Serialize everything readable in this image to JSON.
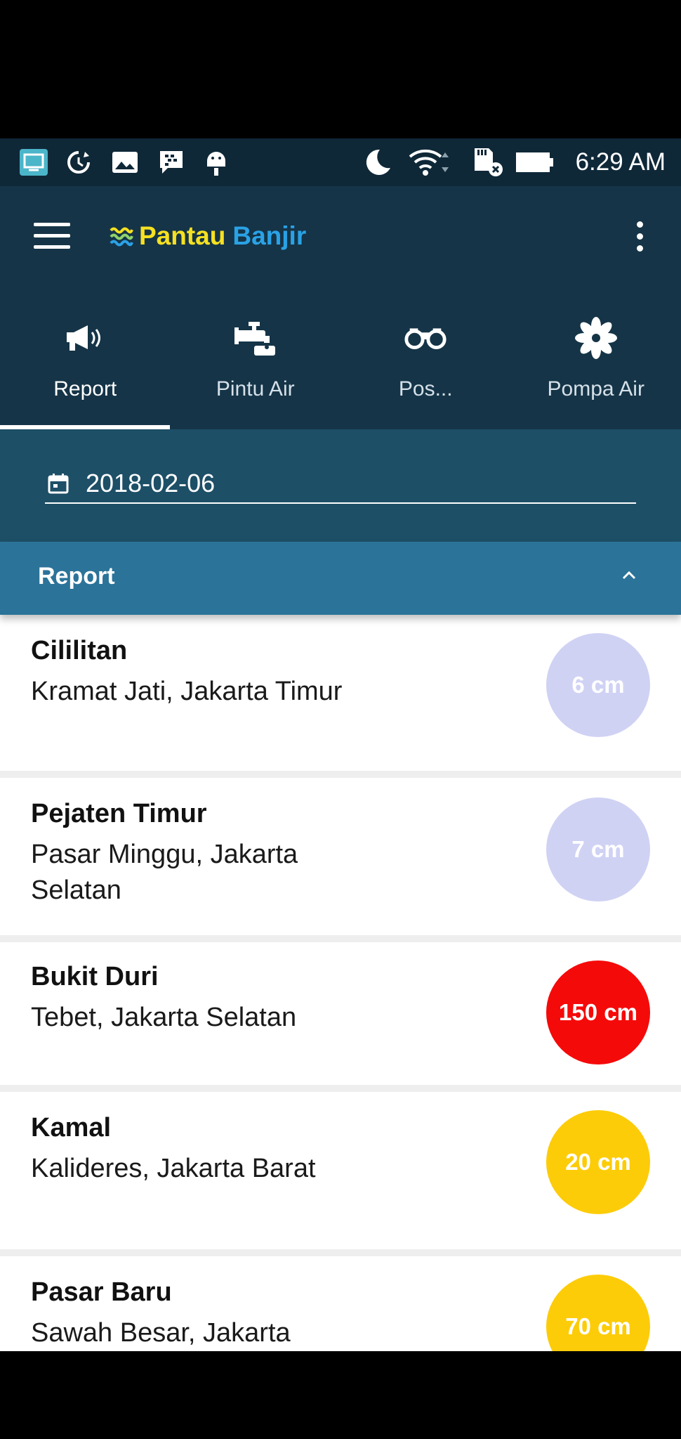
{
  "status_bar": {
    "time": "6:29 AM",
    "icons": [
      "cast-icon",
      "sync-icon",
      "gallery-icon",
      "bbm-icon",
      "android-debug-icon",
      "moon-icon",
      "wifi-icon",
      "sd-card-icon",
      "battery-icon"
    ]
  },
  "app_bar": {
    "brand_part1": "Pantau",
    "brand_part2": "Banjir",
    "menu_icon": "hamburger-icon",
    "overflow_icon": "more-vert-icon"
  },
  "tabs": [
    {
      "label": "Report",
      "icon": "megaphone-icon",
      "active": true
    },
    {
      "label": "Pintu Air",
      "icon": "faucet-icon",
      "active": false
    },
    {
      "label": "Pos...",
      "icon": "binoculars-icon",
      "active": false
    },
    {
      "label": "Pompa Air",
      "icon": "fan-icon",
      "active": false
    }
  ],
  "date_filter": {
    "value": "2018-02-06",
    "icon": "calendar-icon"
  },
  "section": {
    "title": "Report",
    "icon": "chevron-up-icon"
  },
  "reports": [
    {
      "name": "Cililitan",
      "area": "Kramat Jati, Jakarta Timur",
      "level": "6 cm",
      "color": "#d0d2f4"
    },
    {
      "name": "Pejaten Timur",
      "area": "Pasar Minggu, Jakarta Selatan",
      "level": "7 cm",
      "color": "#d0d2f4"
    },
    {
      "name": "Bukit Duri",
      "area": "Tebet, Jakarta Selatan",
      "level": "150 cm",
      "color": "#f50a0a"
    },
    {
      "name": "Kamal",
      "area": "Kalideres, Jakarta Barat",
      "level": "20 cm",
      "color": "#fdcc09"
    },
    {
      "name": "Pasar Baru",
      "area": "Sawah Besar, Jakarta",
      "level": "70 cm",
      "color": "#fdcc09"
    }
  ]
}
